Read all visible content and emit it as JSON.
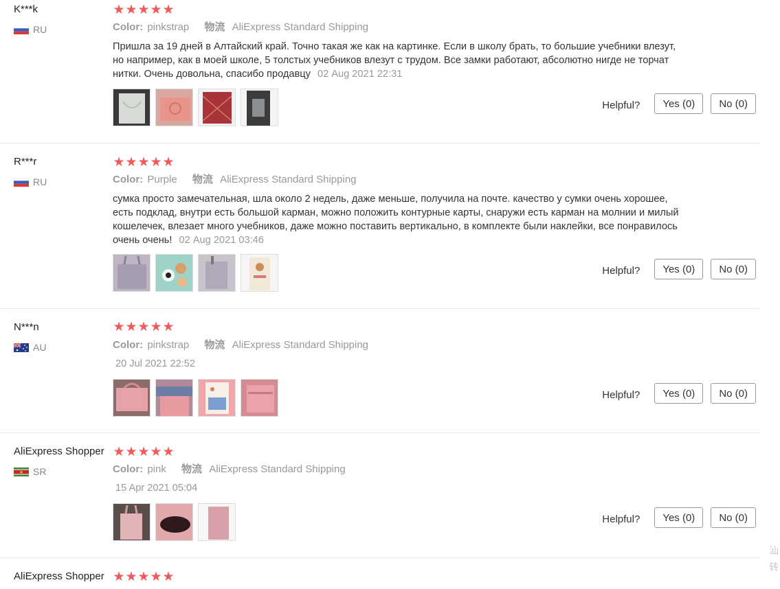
{
  "labels": {
    "color": "Color:",
    "shipping": "物流",
    "helpful": "Helpful?",
    "star": "★"
  },
  "reviews": [
    {
      "user": "K***k",
      "country": "RU",
      "flag": "ru",
      "rating": 5,
      "color": "pinkstrap",
      "shipping": "AliExpress Standard Shipping",
      "text": "Пришла за 19 дней в Алтайский край. Точно такая же как на картинке. Если в школу брать, то большие учебники влезут, но например, как в моей школе, 5 толстых учебников влезут с трудом. Все замки работают, абсолютно нигде не торчат нитки. Очень довольна, спасибо продавцу",
      "date": "02 Aug 2021 22:31",
      "photos": [
        "white-bag-photo",
        "pink-bag-photo",
        "red-pattern-photo",
        "bag-interior-photo"
      ],
      "yes": "Yes (0)",
      "no": "No (0)"
    },
    {
      "user": "R***r",
      "country": "RU",
      "flag": "ru",
      "rating": 5,
      "color": "Purple",
      "shipping": "AliExpress Standard Shipping",
      "text": "сумка просто замечательная, шла около 2 недель, даже меньше, получила на почте. качество у сумки очень хорошее, есть подклад, внутри есть большой карман, можно положить контурные карты, снаружи есть карман на молнии и милый кошелечек, влезает много учебников, даже можно поставить вертикально, в комплекте были наклейки, все понравилось очень очень!",
      "date": "02 Aug 2021 03:46",
      "photos": [
        "purple-bag-photo",
        "stickers-photo",
        "bag-front-photo",
        "wallet-photo"
      ],
      "yes": "Yes (0)",
      "no": "No (0)"
    },
    {
      "user": "N***n",
      "country": "AU",
      "flag": "au",
      "rating": 5,
      "color": "pinkstrap",
      "shipping": "AliExpress Standard Shipping",
      "text": "",
      "date": "20 Jul 2021 22:52",
      "photos": [
        "pink-bag-photo",
        "pink-bag-detail-photo",
        "sticker-card-photo",
        "pink-bag-side-photo"
      ],
      "yes": "Yes (0)",
      "no": "No (0)"
    },
    {
      "user": "AliExpress Shopper",
      "country": "SR",
      "flag": "sr",
      "rating": 5,
      "color": "pink",
      "shipping": "AliExpress Standard Shipping",
      "text": "",
      "date": "15 Apr 2021 05:04",
      "photos": [
        "pink-bag-hanging-photo",
        "bag-opening-photo",
        "pink-pouch-photo"
      ],
      "yes": "Yes (0)",
      "no": "No (0)"
    },
    {
      "user": "AliExpress Shopper",
      "rating": 5
    }
  ],
  "side_note": [
    "汕",
    "转"
  ]
}
